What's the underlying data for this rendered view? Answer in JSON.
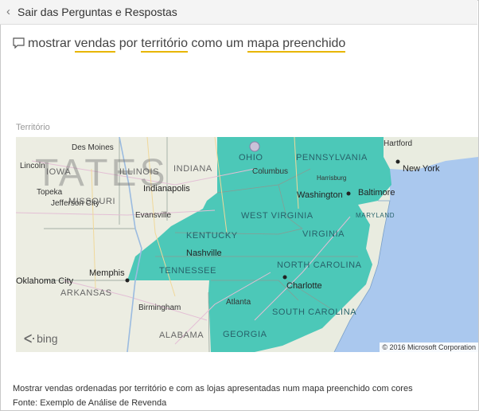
{
  "header": {
    "exit_label": "Sair das Perguntas e Respostas"
  },
  "question": {
    "parts": [
      {
        "text": "mostrar ",
        "hl": false
      },
      {
        "text": "vendas",
        "hl": true
      },
      {
        "text": " por ",
        "hl": false
      },
      {
        "text": "território",
        "hl": true
      },
      {
        "text": " como um ",
        "hl": false
      },
      {
        "text": "mapa preenchido",
        "hl": true
      }
    ]
  },
  "visual": {
    "title": "Território",
    "ghost_text": "TATES",
    "states": [
      "IOWA",
      "ILLINOIS",
      "INDIANA",
      "OHIO",
      "PENNSYLVANIA",
      "MISSOURI",
      "WEST VIRGINIA",
      "KENTUCKY",
      "VIRGINIA",
      "MARYLAND",
      "TENNESSEE",
      "NORTH CAROLINA",
      "ARKANSAS",
      "SOUTH CAROLINA",
      "ALABAMA",
      "GEORGIA"
    ],
    "cities": [
      "Des Moines",
      "Lincoln",
      "Topeka",
      "Jefferson City",
      "Indianapolis",
      "Evansville",
      "Columbus",
      "Harrisburg",
      "Hartford",
      "New York",
      "Washington",
      "Baltimore",
      "Nashville",
      "Memphis",
      "Charlotte",
      "Atlanta",
      "Birmingham",
      "Oklahoma City"
    ],
    "attribution": "© 2016 Microsoft Corporation",
    "provider": "bing",
    "fill_color": "#3ec4b4"
  },
  "footer": {
    "description": "Mostrar vendas ordenadas por território e com as lojas apresentadas num mapa preenchido com cores",
    "source": "Fonte: Exemplo de Análise de Revenda"
  }
}
